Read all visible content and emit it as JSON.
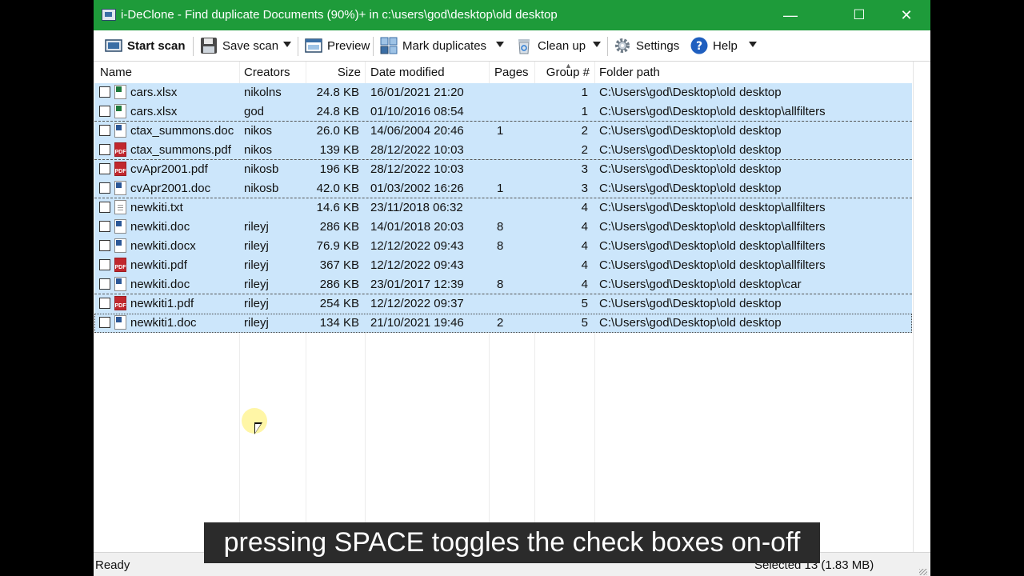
{
  "window": {
    "title": "i-DeClone - Find duplicate Documents (90%)+ in c:\\users\\god\\desktop\\old desktop",
    "minimize": "—",
    "maximize": "☐",
    "close": "✕"
  },
  "toolbar": {
    "start_scan": "Start scan",
    "save_scan": "Save scan",
    "preview": "Preview",
    "mark_duplicates": "Mark duplicates",
    "clean_up": "Clean up",
    "settings": "Settings",
    "help": "Help"
  },
  "columns": {
    "name": "Name",
    "creators": "Creators",
    "size": "Size",
    "date": "Date modified",
    "pages": "Pages",
    "group": "Group #",
    "folder": "Folder path"
  },
  "rows": [
    {
      "name": "cars.xlsx",
      "creators": "nikolns",
      "size": "24.8 KB",
      "date": "16/01/2021 21:20",
      "pages": "",
      "group": "1",
      "folder": "C:\\Users\\god\\Desktop\\old desktop",
      "icon": "excel-file-icon"
    },
    {
      "name": "cars.xlsx",
      "creators": "god",
      "size": "24.8 KB",
      "date": "01/10/2016 08:54",
      "pages": "",
      "group": "1",
      "folder": "C:\\Users\\god\\Desktop\\old desktop\\allfilters",
      "icon": "excel-file-icon"
    },
    {
      "name": "ctax_summons.doc",
      "creators": "nikos",
      "size": "26.0 KB",
      "date": "14/06/2004 20:46",
      "pages": "1",
      "group": "2",
      "folder": "C:\\Users\\god\\Desktop\\old desktop",
      "icon": "word-file-icon"
    },
    {
      "name": "ctax_summons.pdf",
      "creators": "nikos",
      "size": "139 KB",
      "date": "28/12/2022 10:03",
      "pages": "",
      "group": "2",
      "folder": "C:\\Users\\god\\Desktop\\old desktop",
      "icon": "pdf-file-icon"
    },
    {
      "name": "cvApr2001.pdf",
      "creators": "nikosb",
      "size": "196 KB",
      "date": "28/12/2022 10:03",
      "pages": "",
      "group": "3",
      "folder": "C:\\Users\\god\\Desktop\\old desktop",
      "icon": "pdf-file-icon"
    },
    {
      "name": "cvApr2001.doc",
      "creators": "nikosb",
      "size": "42.0 KB",
      "date": "01/03/2002 16:26",
      "pages": "1",
      "group": "3",
      "folder": "C:\\Users\\god\\Desktop\\old desktop",
      "icon": "word-file-icon"
    },
    {
      "name": "newkiti.txt",
      "creators": "",
      "size": "14.6 KB",
      "date": "23/11/2018 06:32",
      "pages": "",
      "group": "4",
      "folder": "C:\\Users\\god\\Desktop\\old desktop\\allfilters",
      "icon": "text-file-icon"
    },
    {
      "name": "newkiti.doc",
      "creators": "rileyj",
      "size": "286 KB",
      "date": "14/01/2018 20:03",
      "pages": "8",
      "group": "4",
      "folder": "C:\\Users\\god\\Desktop\\old desktop\\allfilters",
      "icon": "word-file-icon"
    },
    {
      "name": "newkiti.docx",
      "creators": "rileyj",
      "size": "76.9 KB",
      "date": "12/12/2022 09:43",
      "pages": "8",
      "group": "4",
      "folder": "C:\\Users\\god\\Desktop\\old desktop\\allfilters",
      "icon": "word-file-icon"
    },
    {
      "name": "newkiti.pdf",
      "creators": "rileyj",
      "size": "367 KB",
      "date": "12/12/2022 09:43",
      "pages": "",
      "group": "4",
      "folder": "C:\\Users\\god\\Desktop\\old desktop\\allfilters",
      "icon": "pdf-file-icon"
    },
    {
      "name": "newkiti.doc",
      "creators": "rileyj",
      "size": "286 KB",
      "date": "23/01/2017 12:39",
      "pages": "8",
      "group": "4",
      "folder": "C:\\Users\\god\\Desktop\\old desktop\\car",
      "icon": "word-file-icon"
    },
    {
      "name": "newkiti1.pdf",
      "creators": "rileyj",
      "size": "254 KB",
      "date": "12/12/2022 09:37",
      "pages": "",
      "group": "5",
      "folder": "C:\\Users\\god\\Desktop\\old desktop",
      "icon": "pdf-file-icon"
    },
    {
      "name": "newkiti1.doc",
      "creators": "rileyj",
      "size": "134 KB",
      "date": "21/10/2021 19:46",
      "pages": "2",
      "group": "5",
      "folder": "C:\\Users\\god\\Desktop\\old desktop",
      "icon": "word-file-icon"
    }
  ],
  "pdf_badge": "PDF",
  "status": {
    "left": "Ready",
    "right": "Selected 13 (1.83 MB)"
  },
  "subtitle": "pressing SPACE toggles the check boxes on-off",
  "colors": {
    "titlebar": "#1e9b3a",
    "row_selected": "#cce6fb"
  }
}
